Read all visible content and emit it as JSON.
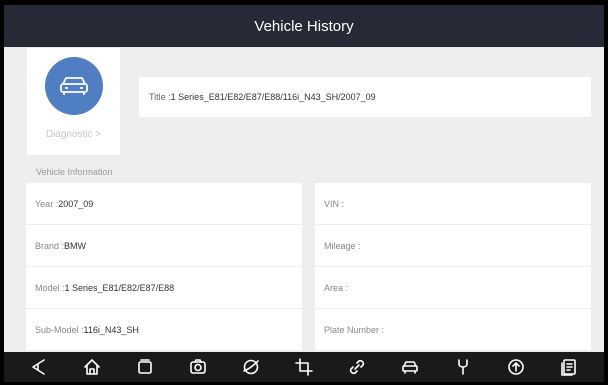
{
  "header": {
    "title": "Vehicle History"
  },
  "card": {
    "diagnostic_link": "Diagnostic >"
  },
  "title_field": {
    "label": "Title : ",
    "value": "1 Series_E81/E82/E87/E88/116i_N43_SH/2007_09"
  },
  "section": {
    "label": "Vehicle Information"
  },
  "info_left": [
    {
      "label": "Year : ",
      "value": "2007_09"
    },
    {
      "label": "Brand : ",
      "value": "BMW"
    },
    {
      "label": "Model : ",
      "value": "1 Series_E81/E82/E87/E88"
    },
    {
      "label": "Sub-Model : ",
      "value": "116i_N43_SH"
    }
  ],
  "info_right": [
    {
      "label": "VIN :",
      "value": ""
    },
    {
      "label": "Mileage :",
      "value": ""
    },
    {
      "label": "Area :",
      "value": ""
    },
    {
      "label": "Plate Number :",
      "value": ""
    }
  ],
  "navbar": {
    "icons": [
      "back-icon",
      "home-icon",
      "recent-apps-icon",
      "camera-icon",
      "browser-icon",
      "crop-icon",
      "link-icon",
      "car-icon",
      "service-icon",
      "upload-icon",
      "report-icon"
    ]
  },
  "colors": {
    "header_bg": "#262a36",
    "accent": "#4f7fc2",
    "background": "#eeeeef",
    "navbar_bg": "#1a1a1a"
  }
}
